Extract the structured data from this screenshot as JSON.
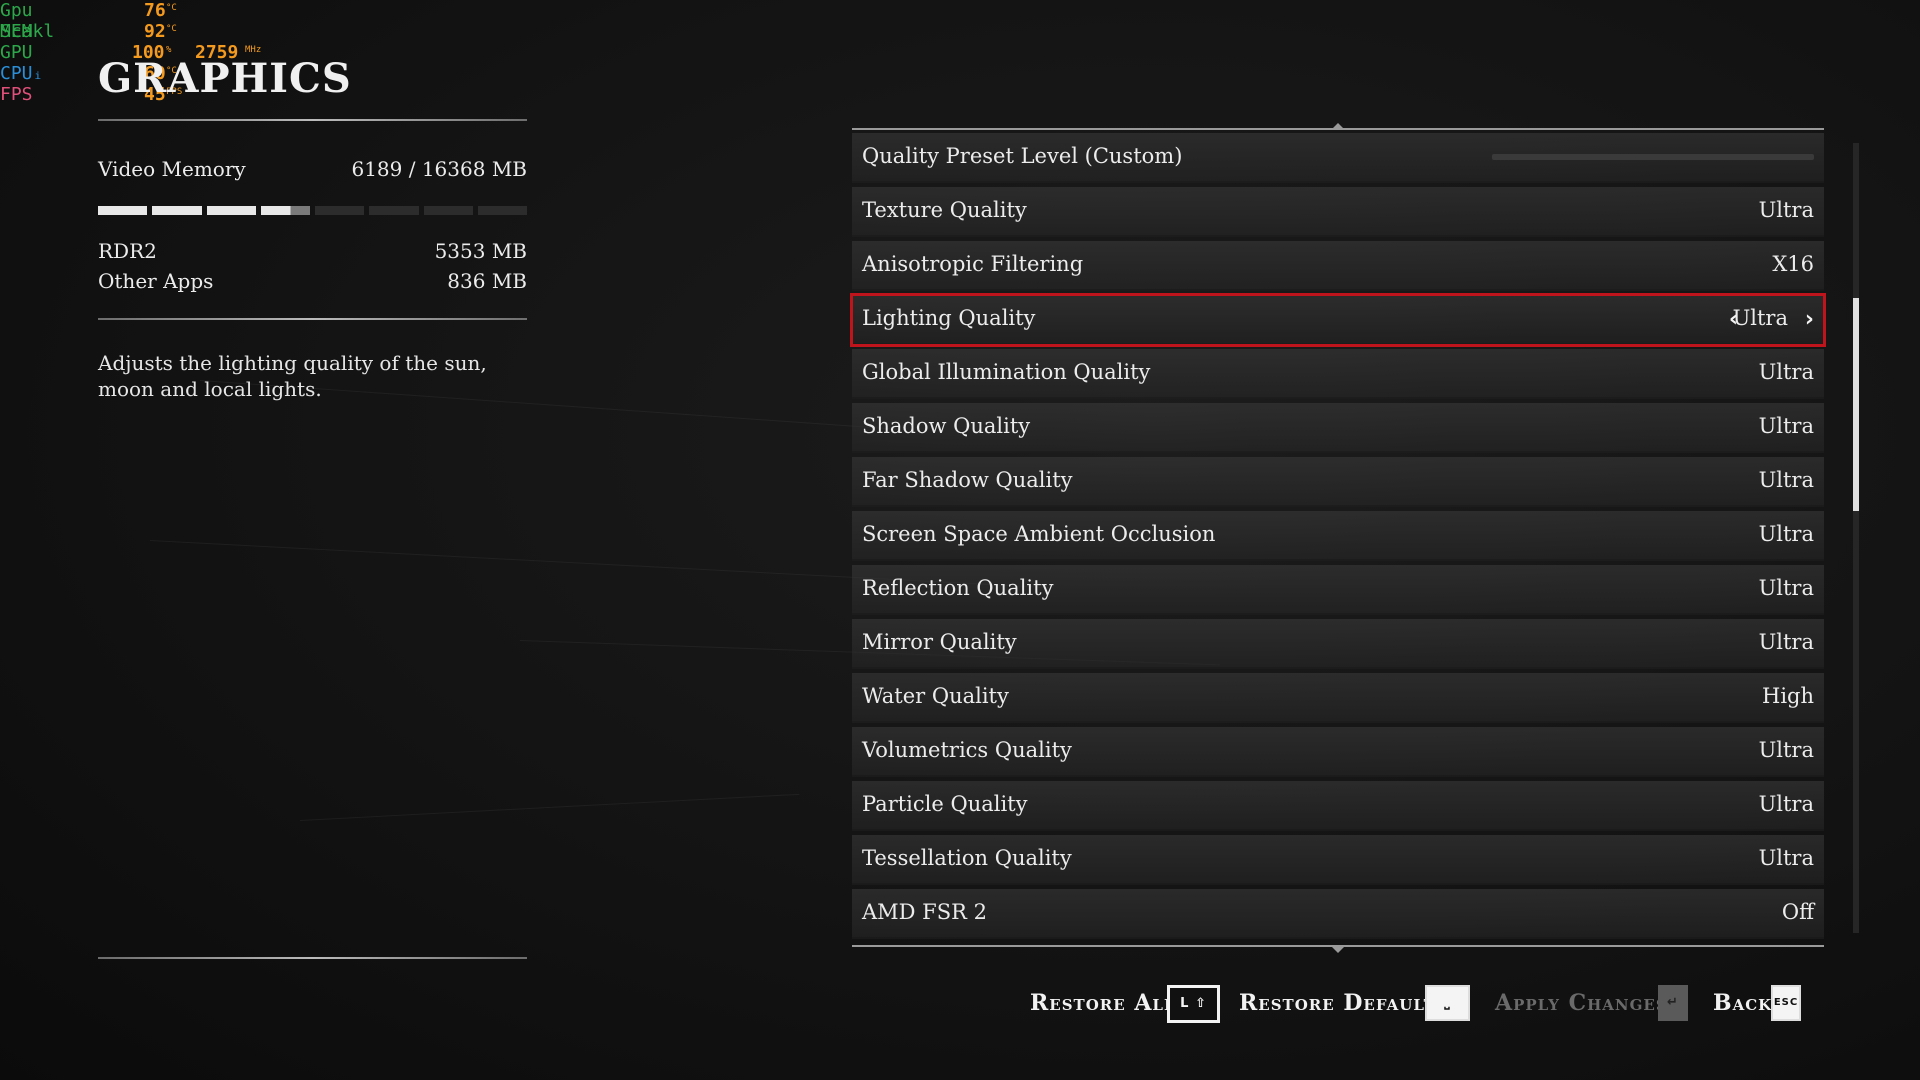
{
  "osd": [
    {
      "label": "Gpu Scakl",
      "label_color": "#2ca84a",
      "value": "76",
      "unit": "°C"
    },
    {
      "label": "MEM",
      "label_color": "#2ca84a",
      "value": "92",
      "unit": "°C"
    },
    {
      "label": "GPU",
      "label_color": "#2ca84a",
      "value": "100",
      "unit": "%",
      "value2": "2759",
      "unit2": "MHz"
    },
    {
      "label": "CPUᵢ",
      "label_color": "#2b8fd8",
      "value": "60",
      "unit": "°C"
    },
    {
      "label": "FPS",
      "label_color": "#e0507a",
      "value": "45",
      "unit": "FPS"
    }
  ],
  "panel": {
    "title": "GRAPHICS",
    "video_memory_label": "Video Memory",
    "video_memory_value": "6189  / 16368  MB",
    "mem_used_fraction": 0.378,
    "rdr2_label": "RDR2",
    "rdr2_value": "5353  MB",
    "other_label": "Other Apps",
    "other_value": "836  MB",
    "description": "Adjusts the lighting quality of the sun, moon and local lights."
  },
  "settings": [
    {
      "label": "Quality Preset Level (Custom)",
      "value": "",
      "type": "slider"
    },
    {
      "label": "Texture Quality",
      "value": "Ultra"
    },
    {
      "label": "Anisotropic Filtering",
      "value": "X16"
    },
    {
      "label": "Lighting Quality",
      "value": "Ultra",
      "selected": true
    },
    {
      "label": "Global Illumination Quality",
      "value": "Ultra"
    },
    {
      "label": "Shadow Quality",
      "value": "Ultra"
    },
    {
      "label": "Far Shadow Quality",
      "value": "Ultra"
    },
    {
      "label": "Screen Space Ambient Occlusion",
      "value": "Ultra"
    },
    {
      "label": "Reflection Quality",
      "value": "Ultra"
    },
    {
      "label": "Mirror Quality",
      "value": "Ultra"
    },
    {
      "label": "Water Quality",
      "value": "High"
    },
    {
      "label": "Volumetrics Quality",
      "value": "Ultra"
    },
    {
      "label": "Particle Quality",
      "value": "Ultra"
    },
    {
      "label": "Tessellation Quality",
      "value": "Ultra"
    },
    {
      "label": "AMD FSR 2",
      "value": "Off"
    }
  ],
  "actions": {
    "restore_all": "Restore All",
    "restore_all_key": "L ⇧",
    "restore_default": "Restore Default",
    "restore_default_key": "⎵",
    "apply_changes": "Apply Changes",
    "apply_changes_key": "↵",
    "back": "Back",
    "back_key": "ESC"
  },
  "colors": {
    "selection": "#c0141c",
    "osd_value": "#f39a1f"
  }
}
